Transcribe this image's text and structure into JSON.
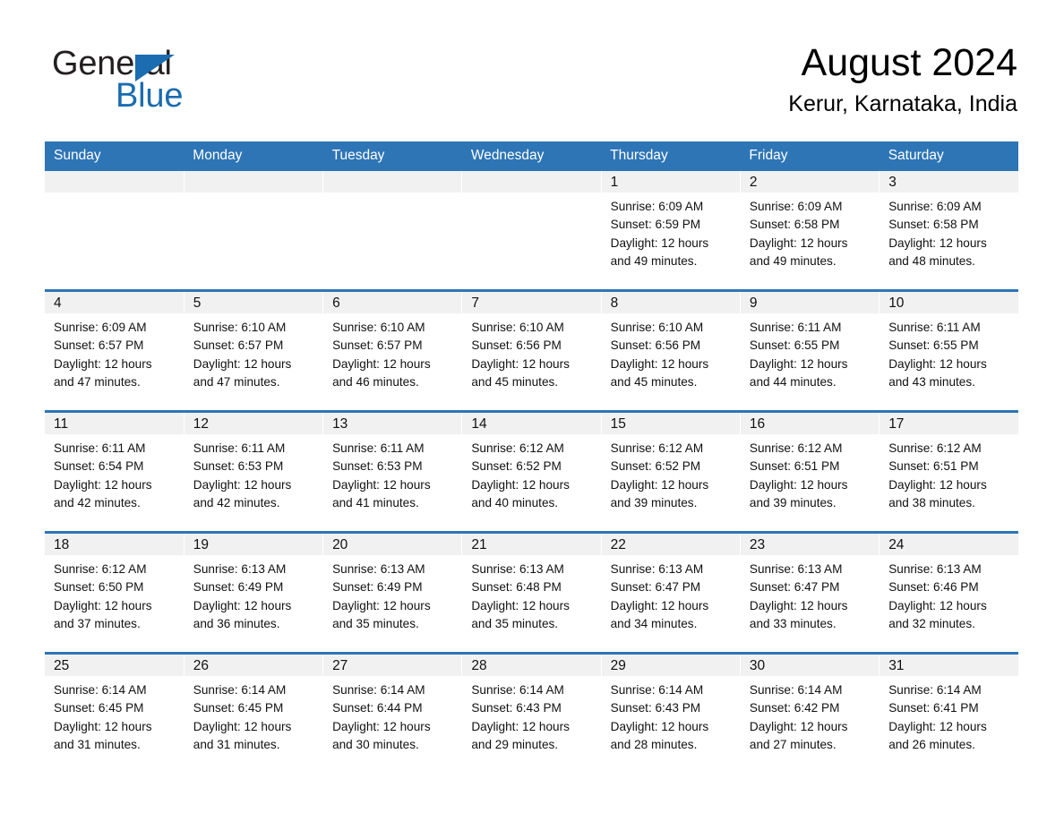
{
  "brand": {
    "word1": "General",
    "word2": "Blue",
    "triangle_color": "#1b6cb0",
    "text_color": "#231f20"
  },
  "header": {
    "month_title": "August 2024",
    "location": "Kerur, Karnataka, India"
  },
  "theme": {
    "header_blue": "#2e75b6",
    "date_strip_gray": "#f1f1f1",
    "row_divider": "#2e75b6",
    "page_background": "#ffffff"
  },
  "calendar": {
    "weekday_headers": [
      "Sunday",
      "Monday",
      "Tuesday",
      "Wednesday",
      "Thursday",
      "Friday",
      "Saturday"
    ],
    "weeks": [
      [
        {
          "day": "",
          "lines": []
        },
        {
          "day": "",
          "lines": []
        },
        {
          "day": "",
          "lines": []
        },
        {
          "day": "",
          "lines": []
        },
        {
          "day": "1",
          "lines": [
            "Sunrise: 6:09 AM",
            "Sunset: 6:59 PM",
            "Daylight: 12 hours",
            "and 49 minutes."
          ]
        },
        {
          "day": "2",
          "lines": [
            "Sunrise: 6:09 AM",
            "Sunset: 6:58 PM",
            "Daylight: 12 hours",
            "and 49 minutes."
          ]
        },
        {
          "day": "3",
          "lines": [
            "Sunrise: 6:09 AM",
            "Sunset: 6:58 PM",
            "Daylight: 12 hours",
            "and 48 minutes."
          ]
        }
      ],
      [
        {
          "day": "4",
          "lines": [
            "Sunrise: 6:09 AM",
            "Sunset: 6:57 PM",
            "Daylight: 12 hours",
            "and 47 minutes."
          ]
        },
        {
          "day": "5",
          "lines": [
            "Sunrise: 6:10 AM",
            "Sunset: 6:57 PM",
            "Daylight: 12 hours",
            "and 47 minutes."
          ]
        },
        {
          "day": "6",
          "lines": [
            "Sunrise: 6:10 AM",
            "Sunset: 6:57 PM",
            "Daylight: 12 hours",
            "and 46 minutes."
          ]
        },
        {
          "day": "7",
          "lines": [
            "Sunrise: 6:10 AM",
            "Sunset: 6:56 PM",
            "Daylight: 12 hours",
            "and 45 minutes."
          ]
        },
        {
          "day": "8",
          "lines": [
            "Sunrise: 6:10 AM",
            "Sunset: 6:56 PM",
            "Daylight: 12 hours",
            "and 45 minutes."
          ]
        },
        {
          "day": "9",
          "lines": [
            "Sunrise: 6:11 AM",
            "Sunset: 6:55 PM",
            "Daylight: 12 hours",
            "and 44 minutes."
          ]
        },
        {
          "day": "10",
          "lines": [
            "Sunrise: 6:11 AM",
            "Sunset: 6:55 PM",
            "Daylight: 12 hours",
            "and 43 minutes."
          ]
        }
      ],
      [
        {
          "day": "11",
          "lines": [
            "Sunrise: 6:11 AM",
            "Sunset: 6:54 PM",
            "Daylight: 12 hours",
            "and 42 minutes."
          ]
        },
        {
          "day": "12",
          "lines": [
            "Sunrise: 6:11 AM",
            "Sunset: 6:53 PM",
            "Daylight: 12 hours",
            "and 42 minutes."
          ]
        },
        {
          "day": "13",
          "lines": [
            "Sunrise: 6:11 AM",
            "Sunset: 6:53 PM",
            "Daylight: 12 hours",
            "and 41 minutes."
          ]
        },
        {
          "day": "14",
          "lines": [
            "Sunrise: 6:12 AM",
            "Sunset: 6:52 PM",
            "Daylight: 12 hours",
            "and 40 minutes."
          ]
        },
        {
          "day": "15",
          "lines": [
            "Sunrise: 6:12 AM",
            "Sunset: 6:52 PM",
            "Daylight: 12 hours",
            "and 39 minutes."
          ]
        },
        {
          "day": "16",
          "lines": [
            "Sunrise: 6:12 AM",
            "Sunset: 6:51 PM",
            "Daylight: 12 hours",
            "and 39 minutes."
          ]
        },
        {
          "day": "17",
          "lines": [
            "Sunrise: 6:12 AM",
            "Sunset: 6:51 PM",
            "Daylight: 12 hours",
            "and 38 minutes."
          ]
        }
      ],
      [
        {
          "day": "18",
          "lines": [
            "Sunrise: 6:12 AM",
            "Sunset: 6:50 PM",
            "Daylight: 12 hours",
            "and 37 minutes."
          ]
        },
        {
          "day": "19",
          "lines": [
            "Sunrise: 6:13 AM",
            "Sunset: 6:49 PM",
            "Daylight: 12 hours",
            "and 36 minutes."
          ]
        },
        {
          "day": "20",
          "lines": [
            "Sunrise: 6:13 AM",
            "Sunset: 6:49 PM",
            "Daylight: 12 hours",
            "and 35 minutes."
          ]
        },
        {
          "day": "21",
          "lines": [
            "Sunrise: 6:13 AM",
            "Sunset: 6:48 PM",
            "Daylight: 12 hours",
            "and 35 minutes."
          ]
        },
        {
          "day": "22",
          "lines": [
            "Sunrise: 6:13 AM",
            "Sunset: 6:47 PM",
            "Daylight: 12 hours",
            "and 34 minutes."
          ]
        },
        {
          "day": "23",
          "lines": [
            "Sunrise: 6:13 AM",
            "Sunset: 6:47 PM",
            "Daylight: 12 hours",
            "and 33 minutes."
          ]
        },
        {
          "day": "24",
          "lines": [
            "Sunrise: 6:13 AM",
            "Sunset: 6:46 PM",
            "Daylight: 12 hours",
            "and 32 minutes."
          ]
        }
      ],
      [
        {
          "day": "25",
          "lines": [
            "Sunrise: 6:14 AM",
            "Sunset: 6:45 PM",
            "Daylight: 12 hours",
            "and 31 minutes."
          ]
        },
        {
          "day": "26",
          "lines": [
            "Sunrise: 6:14 AM",
            "Sunset: 6:45 PM",
            "Daylight: 12 hours",
            "and 31 minutes."
          ]
        },
        {
          "day": "27",
          "lines": [
            "Sunrise: 6:14 AM",
            "Sunset: 6:44 PM",
            "Daylight: 12 hours",
            "and 30 minutes."
          ]
        },
        {
          "day": "28",
          "lines": [
            "Sunrise: 6:14 AM",
            "Sunset: 6:43 PM",
            "Daylight: 12 hours",
            "and 29 minutes."
          ]
        },
        {
          "day": "29",
          "lines": [
            "Sunrise: 6:14 AM",
            "Sunset: 6:43 PM",
            "Daylight: 12 hours",
            "and 28 minutes."
          ]
        },
        {
          "day": "30",
          "lines": [
            "Sunrise: 6:14 AM",
            "Sunset: 6:42 PM",
            "Daylight: 12 hours",
            "and 27 minutes."
          ]
        },
        {
          "day": "31",
          "lines": [
            "Sunrise: 6:14 AM",
            "Sunset: 6:41 PM",
            "Daylight: 12 hours",
            "and 26 minutes."
          ]
        }
      ]
    ]
  }
}
